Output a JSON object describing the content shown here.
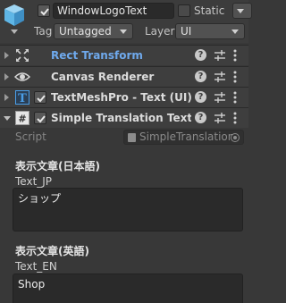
{
  "header": {
    "object_name": "WindowLogoText",
    "static_label": "Static",
    "tag_label": "Tag",
    "tag_value": "Untagged",
    "layer_label": "Layer",
    "layer_value": "UI"
  },
  "components": [
    {
      "title": "Rect Transform",
      "icon": "rect-transform-icon"
    },
    {
      "title": "Canvas Renderer",
      "icon": "eye-icon"
    },
    {
      "title": "TextMeshPro - Text (UI)",
      "icon": "text-t-icon"
    },
    {
      "title": "Simple Translation Text (Sc",
      "icon": "script-hash-icon"
    }
  ],
  "script": {
    "label": "Script",
    "value": "SimpleTranslation"
  },
  "fields": [
    {
      "heading": "表示文章(日本語)",
      "label": "Text_JP",
      "value": "ショップ"
    },
    {
      "heading": "表示文章(英語)",
      "label": "Text_EN",
      "value": "Shop"
    }
  ],
  "colors": {
    "background": "#383838",
    "accent_checkbox": "#595959",
    "rect_transform_title": "#6fa9ec",
    "textmeshpro_icon": "#4a9ee8",
    "cube_icon": "#5fb6e6"
  }
}
